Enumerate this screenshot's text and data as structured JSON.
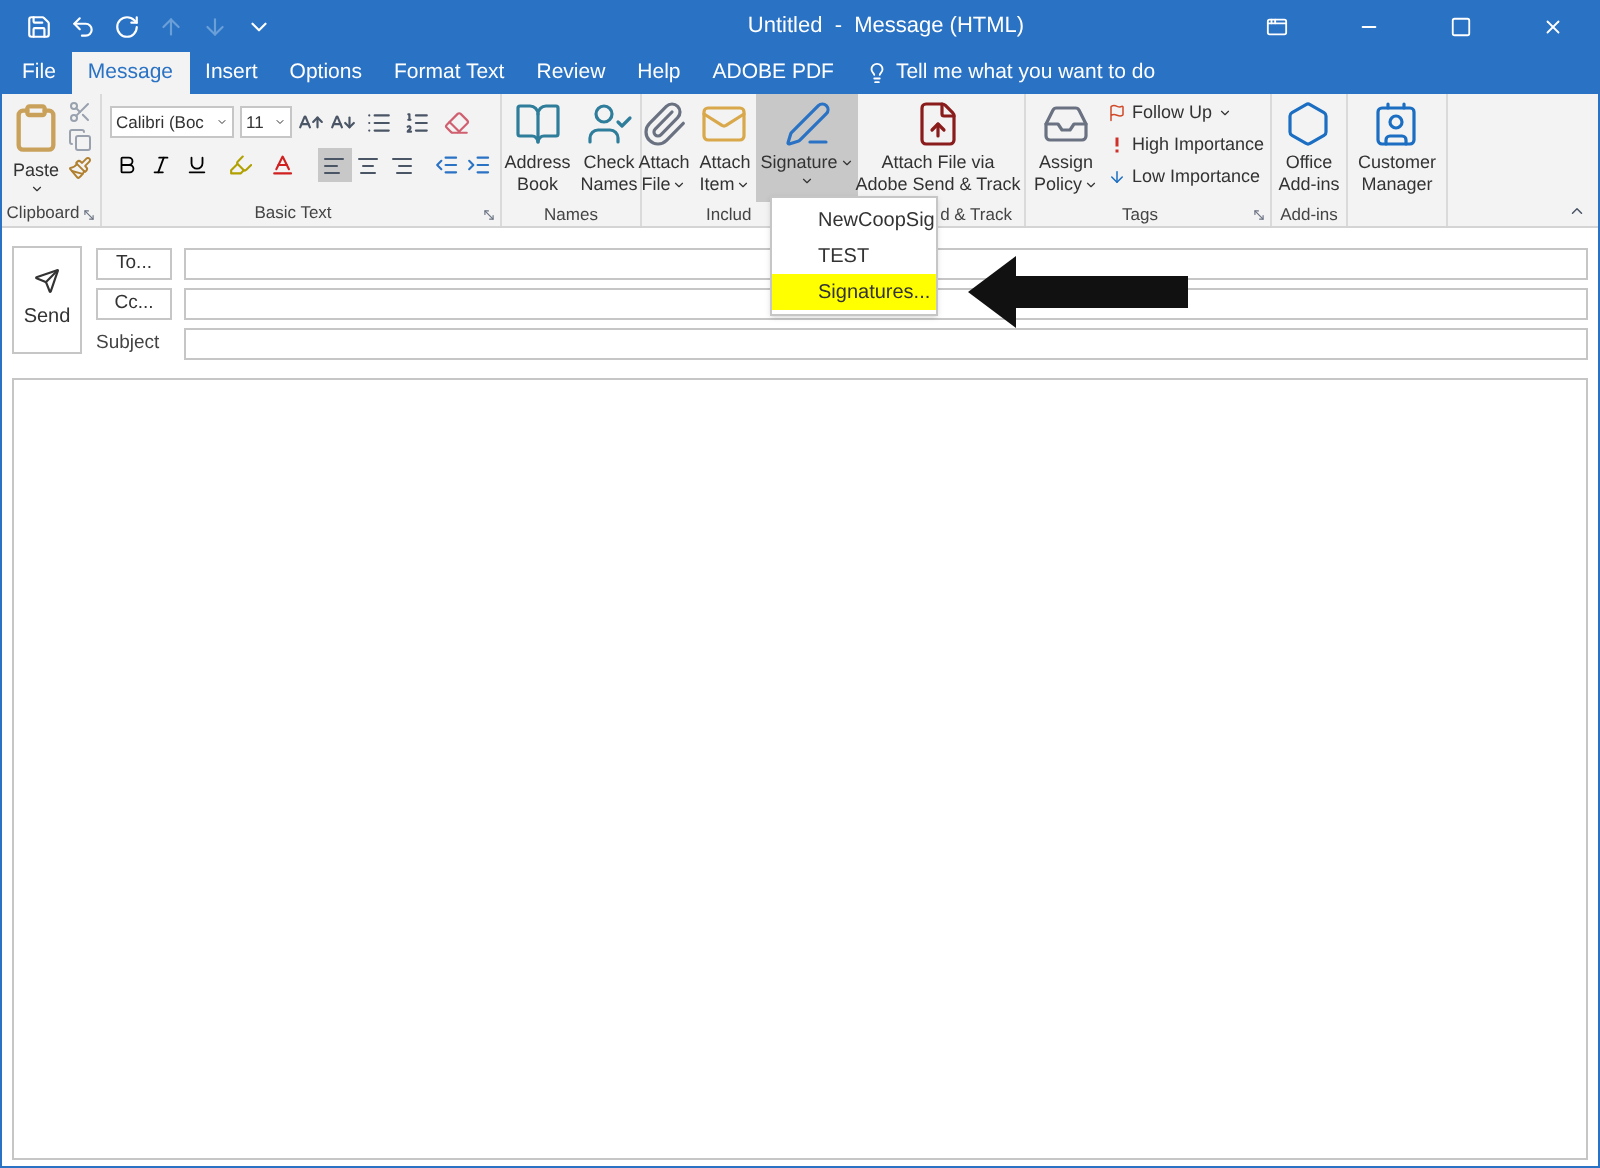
{
  "window": {
    "title": "Untitled  -  Message (HTML)"
  },
  "quick_access": [
    {
      "kind": "save",
      "disabled": false
    },
    {
      "kind": "undo",
      "disabled": false
    },
    {
      "kind": "redo",
      "disabled": false
    },
    {
      "kind": "up",
      "disabled": true
    },
    {
      "kind": "down",
      "disabled": true
    },
    {
      "kind": "customize",
      "disabled": false
    }
  ],
  "window_controls": [
    {
      "kind": "ribbon_options"
    },
    {
      "kind": "minimize"
    },
    {
      "kind": "maximize"
    },
    {
      "kind": "close"
    }
  ],
  "tabs": [
    {
      "label": "File",
      "selected": false
    },
    {
      "label": "Message",
      "selected": true
    },
    {
      "label": "Insert",
      "selected": false
    },
    {
      "label": "Options",
      "selected": false
    },
    {
      "label": "Format Text",
      "selected": false
    },
    {
      "label": "Review",
      "selected": false
    },
    {
      "label": "Help",
      "selected": false
    },
    {
      "label": "ADOBE PDF",
      "selected": false
    }
  ],
  "tell_me": "Tell me what you want to do",
  "ribbon": {
    "groups": [
      {
        "kind": "clipboard",
        "label": "Clipboard",
        "launcher": true,
        "paste": "Paste"
      },
      {
        "kind": "basic_text",
        "label": "Basic Text",
        "launcher": true,
        "font": "Calibri (Boc",
        "size": "11",
        "alignment": [
          {
            "kind": "left",
            "selected": true
          },
          {
            "kind": "center",
            "selected": false
          },
          {
            "kind": "right",
            "selected": false
          }
        ]
      },
      {
        "kind": "names",
        "label": "Names",
        "launcher": false,
        "buttons": [
          {
            "lines": [
              "Address",
              "Book"
            ],
            "dropdown": false,
            "pressed": false
          },
          {
            "lines": [
              "Check",
              "Names"
            ],
            "dropdown": false,
            "pressed": false
          }
        ]
      },
      {
        "kind": "include",
        "label": "Includ",
        "launcher": false,
        "buttons": [
          {
            "lines": [
              "Attach",
              "File"
            ],
            "dropdown": true,
            "pressed": false
          },
          {
            "lines": [
              "Attach",
              "Item"
            ],
            "dropdown": true,
            "pressed": false
          },
          {
            "lines": [
              "Signature"
            ],
            "dropdown": true,
            "pressed": true
          }
        ]
      },
      {
        "kind": "adobe",
        "label": "d & Track",
        "launcher": false,
        "buttons": [
          {
            "lines": [
              "Attach File via",
              "Adobe Send & Track"
            ],
            "dropdown": false,
            "pressed": false
          }
        ]
      },
      {
        "kind": "tags",
        "label": "Tags",
        "launcher": true,
        "buttons": [
          {
            "lines": [
              "Assign",
              "Policy"
            ],
            "dropdown": true,
            "pressed": false
          }
        ],
        "items": [
          {
            "text": "Follow Up",
            "dropdown": true
          },
          {
            "text": "High Importance",
            "dropdown": false
          },
          {
            "text": "Low Importance",
            "dropdown": false
          }
        ]
      },
      {
        "kind": "addins",
        "label": "Add-ins",
        "launcher": false,
        "buttons": [
          {
            "lines": [
              "Office",
              "Add-ins"
            ],
            "dropdown": false,
            "pressed": false
          }
        ]
      },
      {
        "kind": "customer",
        "launcher": false,
        "buttons": [
          {
            "lines": [
              "Customer",
              "Manager"
            ],
            "dropdown": false,
            "pressed": false
          }
        ]
      }
    ]
  },
  "signature_menu": {
    "items": [
      {
        "label": "NewCoopSig",
        "selected": false
      },
      {
        "label": "TEST",
        "selected": false
      },
      {
        "label": "Signatures...",
        "selected": true
      }
    ]
  },
  "compose": {
    "send": "Send",
    "recipients": [
      {
        "button": "To..."
      },
      {
        "button": "Cc..."
      }
    ],
    "subject_label": "Subject"
  }
}
